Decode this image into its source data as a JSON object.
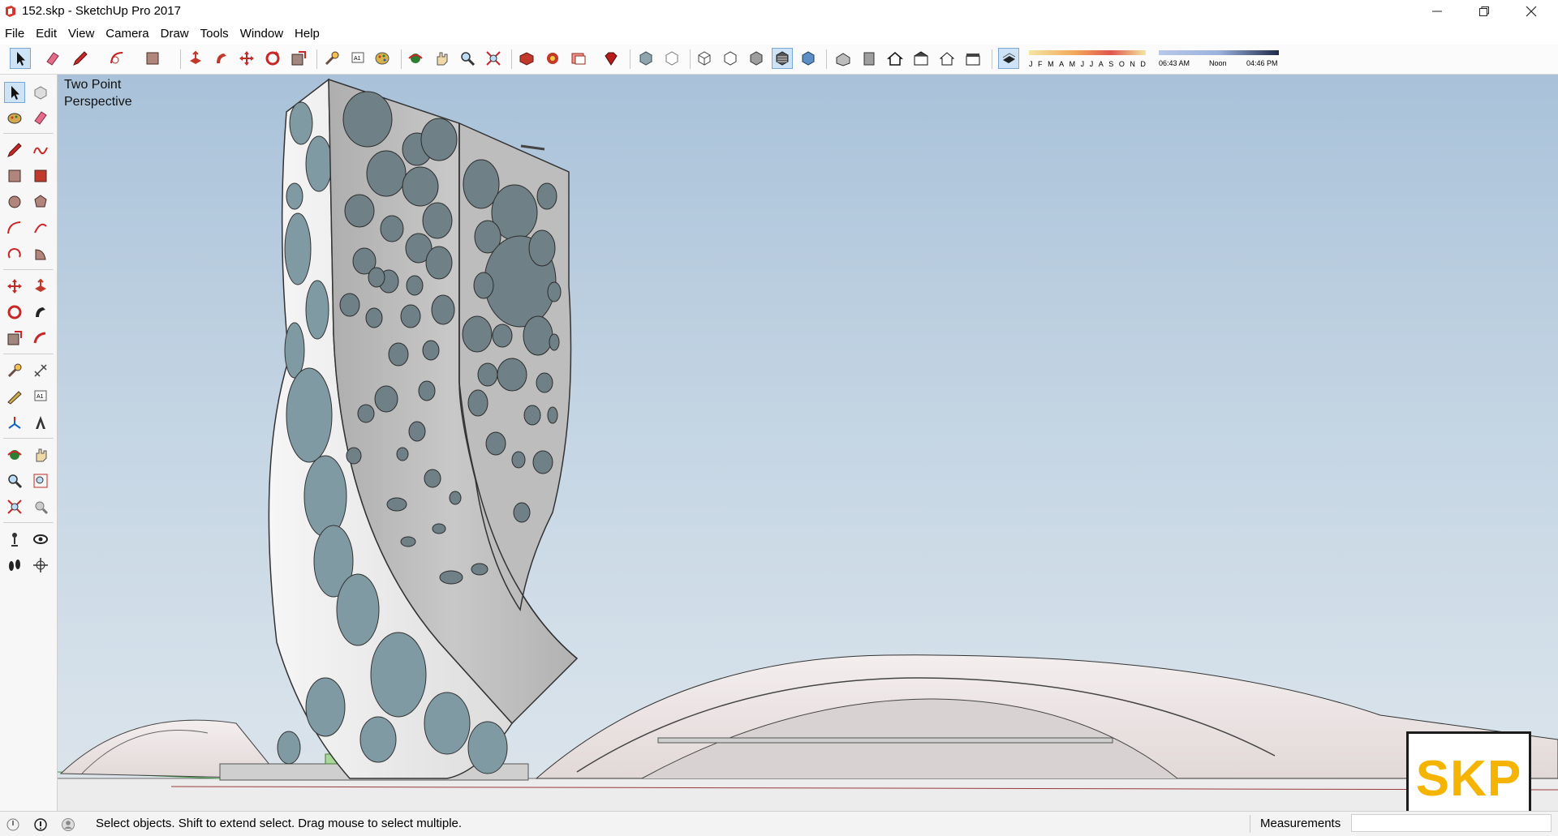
{
  "window": {
    "title": "152.skp - SketchUp Pro 2017",
    "controls": [
      "minimize",
      "restore",
      "close"
    ]
  },
  "menu": {
    "items": [
      "File",
      "Edit",
      "View",
      "Camera",
      "Draw",
      "Tools",
      "Window",
      "Help"
    ]
  },
  "toolbar": {
    "icons": [
      "select-icon",
      "eraser-icon",
      "pencil-icon",
      "arc-icon",
      "paint-bucket-icon",
      "push-pull-icon",
      "follow-me-icon",
      "move-icon",
      "rotate-icon",
      "scale-icon",
      "tape-measure-icon",
      "text-icon",
      "paint-icon",
      "orbit-icon",
      "pan-icon",
      "zoom-icon",
      "zoom-extents-icon",
      "3d-warehouse-icon",
      "extension-warehouse-icon",
      "layout-icon",
      "ruby-icon",
      "xray-icon",
      "back-edges-icon",
      "wireframe-icon",
      "hidden-line-icon",
      "shaded-icon",
      "shaded-textures-icon",
      "monochrome-icon",
      "iso-view-icon",
      "top-view-icon",
      "front-view-icon",
      "right-view-icon",
      "back-view-icon",
      "left-view-icon",
      "shadows-toggle-icon"
    ],
    "active_tool": "shaded-textures-icon",
    "shadows": {
      "months": [
        "J",
        "F",
        "M",
        "A",
        "M",
        "J",
        "J",
        "A",
        "S",
        "O",
        "N",
        "D"
      ],
      "time_start": "06:43 AM",
      "time_mid": "Noon",
      "time_end": "04:46 PM"
    }
  },
  "left_toolbar": {
    "icons": [
      "select-icon",
      "component-icon",
      "paint-bucket-icon",
      "eraser-icon",
      "line-icon",
      "freehand-icon",
      "rectangle-icon",
      "rotated-rectangle-icon",
      "circle-icon",
      "polygon-icon",
      "arc-icon",
      "two-point-arc-icon",
      "three-point-arc-icon",
      "pie-icon",
      "move-icon",
      "push-pull-icon",
      "rotate-icon",
      "follow-me-icon",
      "scale-icon",
      "offset-icon",
      "tape-measure-icon",
      "dimension-icon",
      "protractor-icon",
      "text-icon",
      "axes-icon",
      "3d-text-icon",
      "orbit-icon",
      "pan-icon",
      "zoom-icon",
      "zoom-window-icon",
      "zoom-extents-icon",
      "previous-view-icon",
      "position-camera-icon",
      "look-around-icon",
      "walk-icon",
      "section-plane-icon"
    ]
  },
  "viewport": {
    "camera_label": "Two Point\nPerspective",
    "badge": "SKP"
  },
  "status": {
    "hint": "Select objects. Shift to extend select. Drag mouse to select multiple.",
    "measurements_label": "Measurements",
    "measurements_value": ""
  }
}
